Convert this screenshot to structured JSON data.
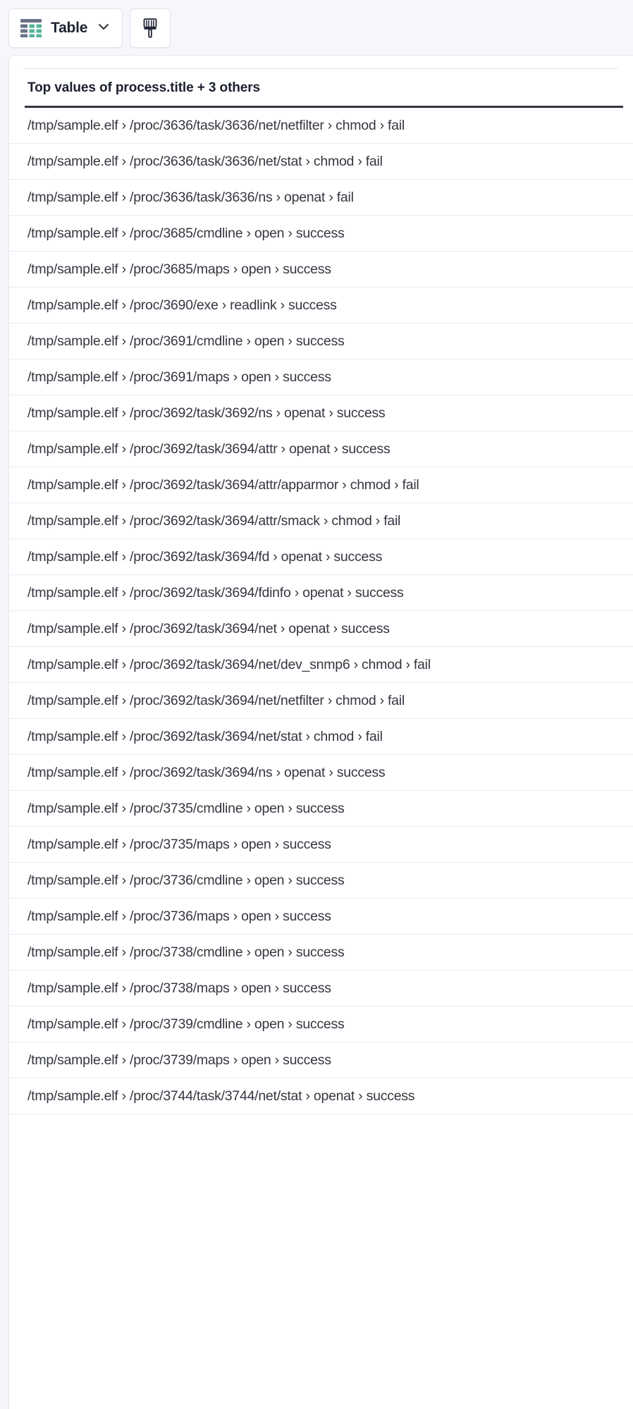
{
  "toolbar": {
    "table_button_label": "Table",
    "table_icon_name": "table-grid-icon",
    "chevron_icon_name": "chevron-down-icon",
    "style_button_icon_name": "paint-brush-icon",
    "accent_green": "#54b399",
    "accent_slate": "#6a7288"
  },
  "panel": {
    "title": "Top values of process.title + 3 others",
    "rows": [
      "/tmp/sample.elf › /proc/3636/task/3636/net/netfilter › chmod › fail",
      "/tmp/sample.elf › /proc/3636/task/3636/net/stat › chmod › fail",
      "/tmp/sample.elf › /proc/3636/task/3636/ns › openat › fail",
      "/tmp/sample.elf › /proc/3685/cmdline › open › success",
      "/tmp/sample.elf › /proc/3685/maps › open › success",
      "/tmp/sample.elf › /proc/3690/exe › readlink › success",
      "/tmp/sample.elf › /proc/3691/cmdline › open › success",
      "/tmp/sample.elf › /proc/3691/maps › open › success",
      "/tmp/sample.elf › /proc/3692/task/3692/ns › openat › success",
      "/tmp/sample.elf › /proc/3692/task/3694/attr › openat › success",
      "/tmp/sample.elf › /proc/3692/task/3694/attr/apparmor › chmod › fail",
      "/tmp/sample.elf › /proc/3692/task/3694/attr/smack › chmod › fail",
      "/tmp/sample.elf › /proc/3692/task/3694/fd › openat › success",
      "/tmp/sample.elf › /proc/3692/task/3694/fdinfo › openat › success",
      "/tmp/sample.elf › /proc/3692/task/3694/net › openat › success",
      "/tmp/sample.elf › /proc/3692/task/3694/net/dev_snmp6 › chmod › fail",
      "/tmp/sample.elf › /proc/3692/task/3694/net/netfilter › chmod › fail",
      "/tmp/sample.elf › /proc/3692/task/3694/net/stat › chmod › fail",
      "/tmp/sample.elf › /proc/3692/task/3694/ns › openat › success",
      "/tmp/sample.elf › /proc/3735/cmdline › open › success",
      "/tmp/sample.elf › /proc/3735/maps › open › success",
      "/tmp/sample.elf › /proc/3736/cmdline › open › success",
      "/tmp/sample.elf › /proc/3736/maps › open › success",
      "/tmp/sample.elf › /proc/3738/cmdline › open › success",
      "/tmp/sample.elf › /proc/3738/maps › open › success",
      "/tmp/sample.elf › /proc/3739/cmdline › open › success",
      "/tmp/sample.elf › /proc/3739/maps › open › success",
      "/tmp/sample.elf › /proc/3744/task/3744/net/stat › openat › success"
    ]
  }
}
